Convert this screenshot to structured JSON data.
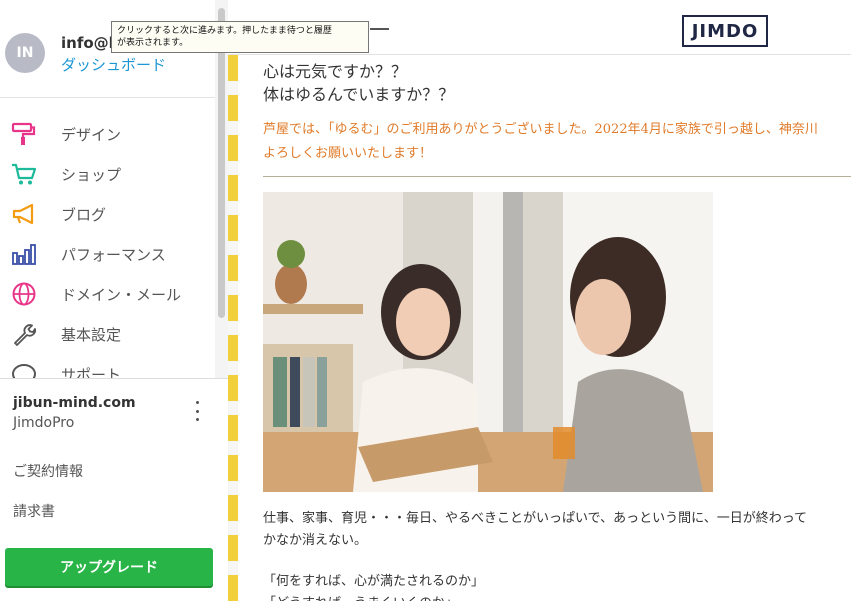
{
  "sidebar": {
    "avatar_initials": "IN",
    "account_email": "info@k",
    "dashboard_label": "ダッシュボード",
    "items": [
      {
        "label": "デザイン",
        "icon": "paint-roller-icon",
        "color": "#e8358a"
      },
      {
        "label": "ショップ",
        "icon": "cart-icon",
        "color": "#1db99b"
      },
      {
        "label": "ブログ",
        "icon": "megaphone-icon",
        "color": "#f39c12"
      },
      {
        "label": "パフォーマンス",
        "icon": "bar-chart-icon",
        "color": "#3a4fa8"
      },
      {
        "label": "ドメイン・メール",
        "icon": "globe-icon",
        "color": "#e8358a"
      },
      {
        "label": "基本設定",
        "icon": "wrench-icon",
        "color": "#555555"
      },
      {
        "label": "サポート",
        "icon": "chat-bubble-icon",
        "color": "#555555"
      }
    ]
  },
  "site_panel": {
    "domain": "jibun-mind.com",
    "plan": "JimdoPro",
    "contract_label": "ご契約情報",
    "invoice_label": "請求書",
    "upgrade_label": "アップグレード",
    "upgrade_color": "#28b446"
  },
  "tooltip": {
    "line1": "クリックすると次に進みます。押したまま待つと履歴",
    "line2": "が表示されます。"
  },
  "header": {
    "logo_text": "JIMDO"
  },
  "content": {
    "heading1": "心は元気ですか？？",
    "heading2": "体はゆるんでいますか？？",
    "orange1": "芦屋では、「ゆるむ」のご利用ありがとうございました。2022年4月に家族で引っ越し、神奈川",
    "orange2": "よろしくお願いいたします！",
    "orange_color": "#e07b2a",
    "body1": "仕事、家事、育児・・・毎日、やるべきことがいっぱいで、あっという間に、一日が終わって",
    "body2": "かなか消えない。",
    "body3": "「何をすれば、心が満たされるのか」",
    "body4": "「どうすれば、うまくいくのか」"
  }
}
